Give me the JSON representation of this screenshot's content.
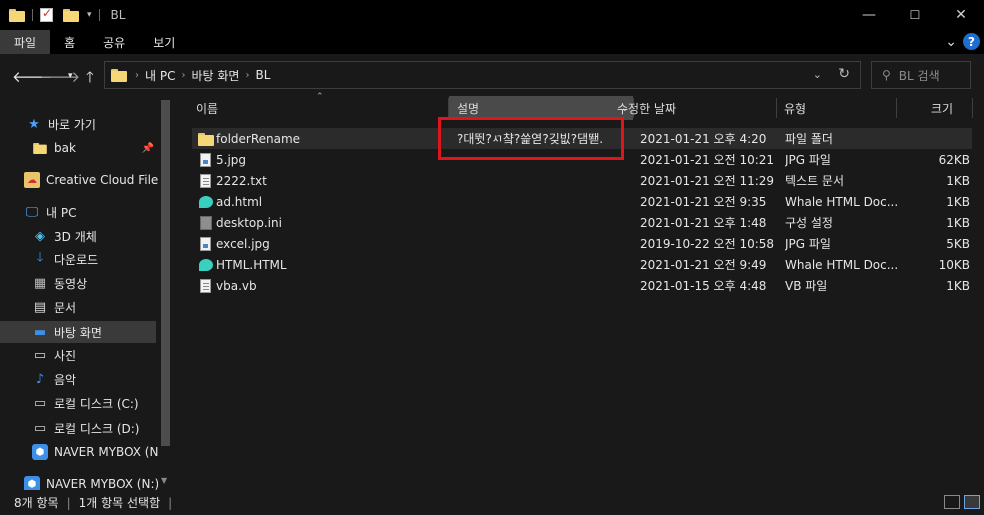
{
  "window": {
    "title": "BL",
    "minimize": "—",
    "maximize": "☐",
    "close": "✕"
  },
  "ribbon": {
    "tabs": [
      "파일",
      "홈",
      "공유",
      "보기"
    ],
    "help": "?",
    "expand": "⌄"
  },
  "address": {
    "crumbs": [
      "내 PC",
      "바탕 화면",
      "BL"
    ],
    "search_placeholder": "BL 검색"
  },
  "sidebar": {
    "items": [
      {
        "label": "바로 가기",
        "icon": "star-icon"
      },
      {
        "label": "bak",
        "icon": "folder-icon"
      },
      {
        "label": "Creative Cloud Files",
        "icon": "creative-cloud-icon"
      },
      {
        "label": "내 PC",
        "icon": "computer-icon"
      },
      {
        "label": "3D 개체",
        "icon": "cube-icon"
      },
      {
        "label": "다운로드",
        "icon": "download-icon"
      },
      {
        "label": "동영상",
        "icon": "video-icon"
      },
      {
        "label": "문서",
        "icon": "document-icon"
      },
      {
        "label": "바탕 화면",
        "icon": "desktop-icon"
      },
      {
        "label": "사진",
        "icon": "picture-icon"
      },
      {
        "label": "음악",
        "icon": "music-icon"
      },
      {
        "label": "로컬 디스크 (C:)",
        "icon": "disk-icon"
      },
      {
        "label": "로컬 디스크 (D:)",
        "icon": "disk-icon"
      },
      {
        "label": "NAVER MYBOX (N:)",
        "icon": "mybox-icon"
      },
      {
        "label": "NAVER MYBOX (N:)",
        "icon": "mybox-icon"
      }
    ]
  },
  "columns": {
    "name": "이름",
    "description": "설명",
    "modified": "수정한 날짜",
    "type": "유형",
    "size": "크기"
  },
  "files": [
    {
      "name": "folderRename",
      "description": "?대뜃?ㅺ챸?쓽엳?깆빖?댐뙏.",
      "modified": "2021-01-21 오후 4:20",
      "type": "파일 폴더",
      "size": "",
      "icon": "folder-icon"
    },
    {
      "name": "5.jpg",
      "description": "",
      "modified": "2021-01-21 오전 10:21",
      "type": "JPG 파일",
      "size": "62KB",
      "icon": "image-file-icon"
    },
    {
      "name": "2222.txt",
      "description": "",
      "modified": "2021-01-21 오전 11:29",
      "type": "텍스트 문서",
      "size": "1KB",
      "icon": "text-file-icon"
    },
    {
      "name": "ad.html",
      "description": "",
      "modified": "2021-01-21 오전 9:35",
      "type": "Whale HTML Doc...",
      "size": "1KB",
      "icon": "whale-icon"
    },
    {
      "name": "desktop.ini",
      "description": "",
      "modified": "2021-01-21 오후 1:48",
      "type": "구성 설정",
      "size": "1KB",
      "icon": "ini-file-icon"
    },
    {
      "name": "excel.jpg",
      "description": "",
      "modified": "2019-10-22 오전 10:58",
      "type": "JPG 파일",
      "size": "5KB",
      "icon": "image-file-icon"
    },
    {
      "name": "HTML.HTML",
      "description": "",
      "modified": "2021-01-21 오전 9:49",
      "type": "Whale HTML Doc...",
      "size": "10KB",
      "icon": "whale-icon"
    },
    {
      "name": "vba.vb",
      "description": "",
      "modified": "2021-01-15 오후 4:48",
      "type": "VB 파일",
      "size": "1KB",
      "icon": "vb-file-icon"
    }
  ],
  "status": {
    "count": "8개 항목",
    "selection": "1개 항목 선택함"
  },
  "colors": {
    "highlight_box": "#e0141b",
    "background": "#191919"
  }
}
